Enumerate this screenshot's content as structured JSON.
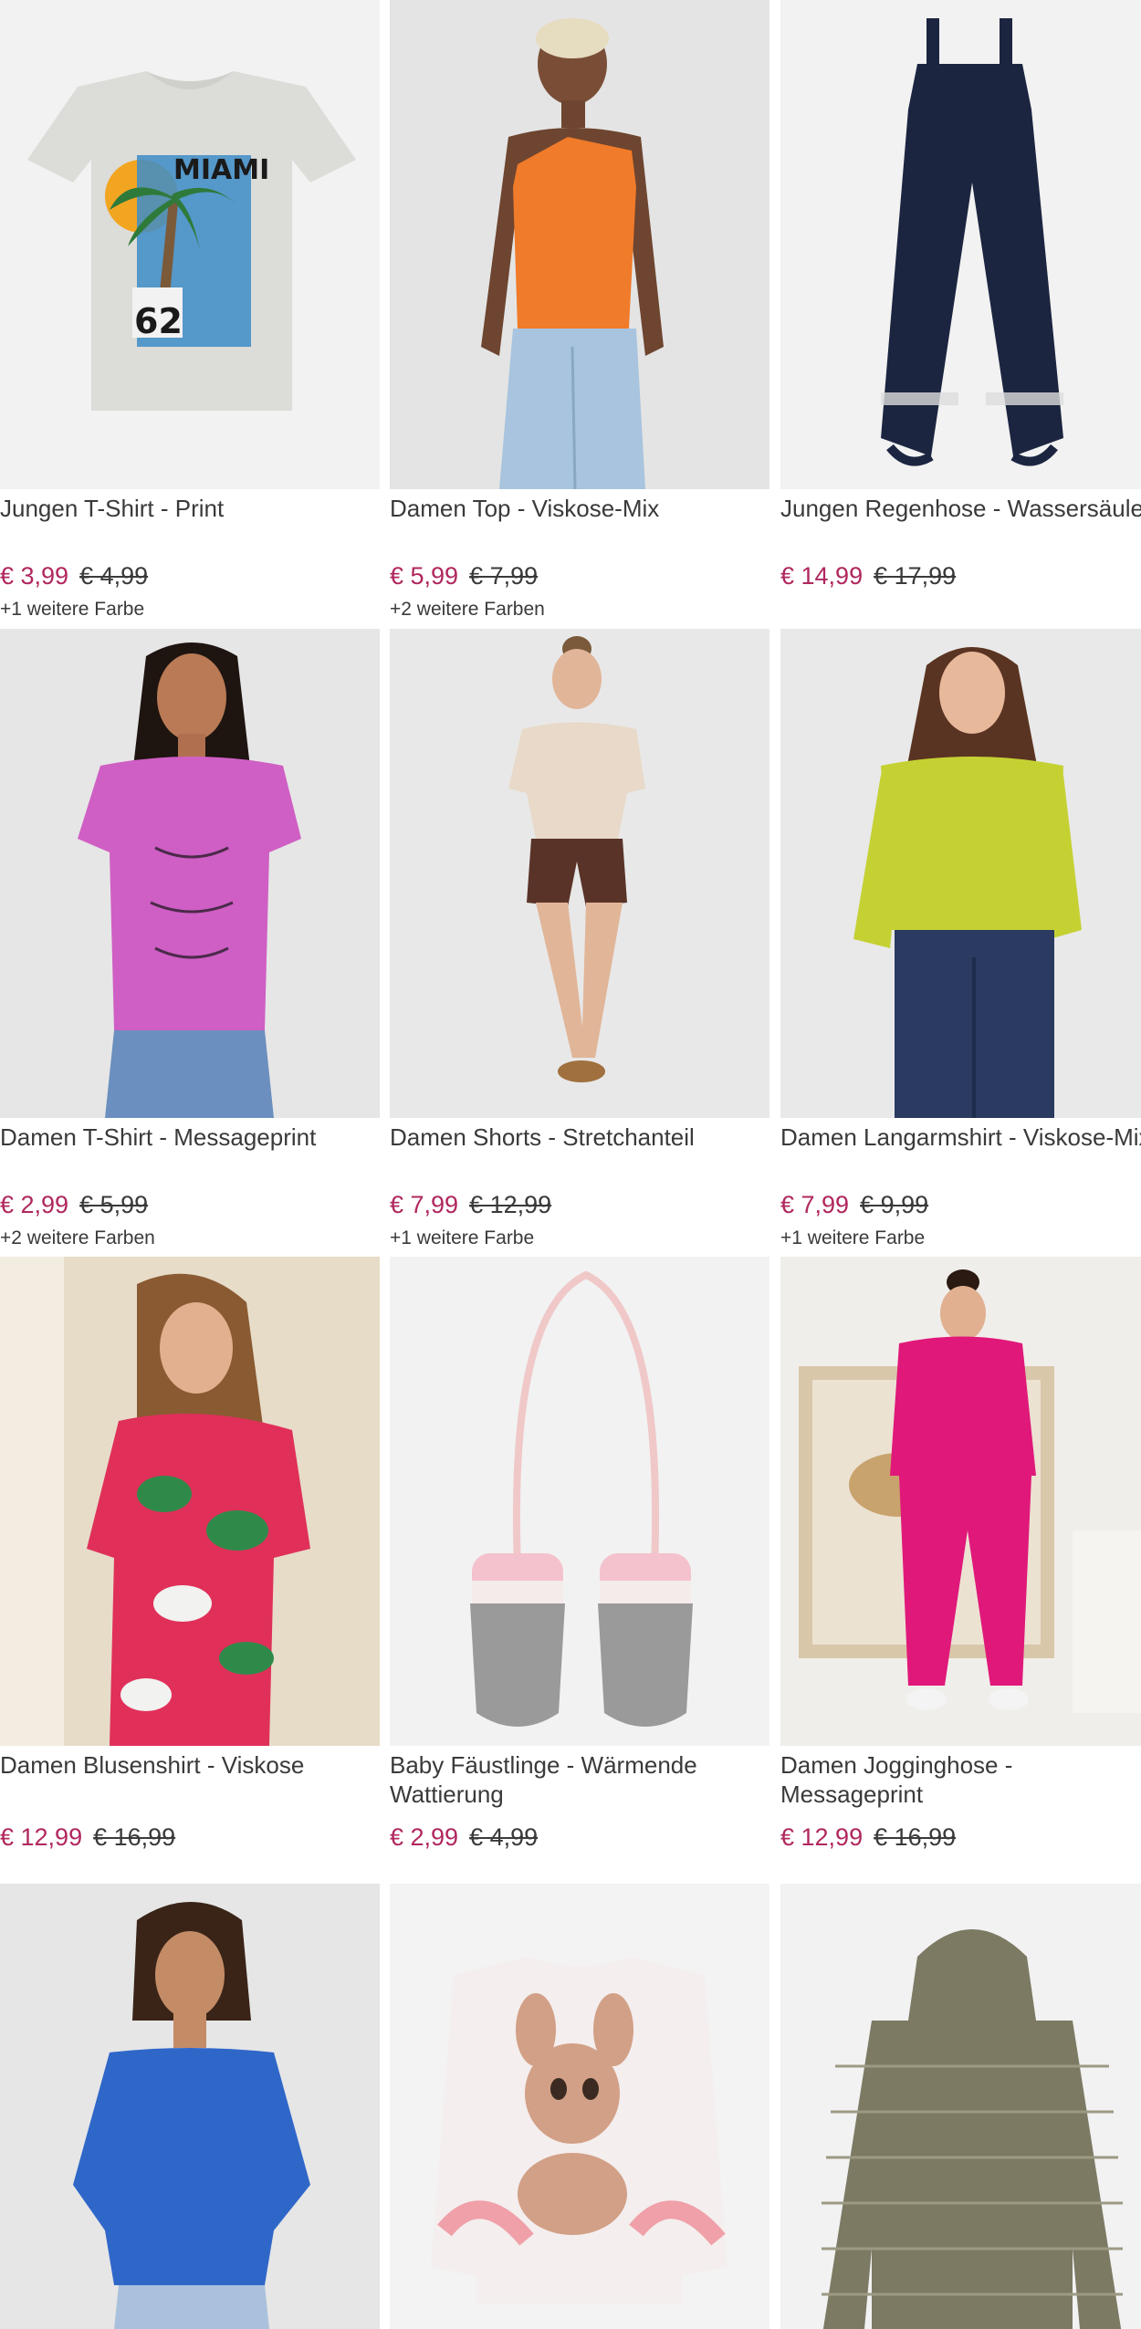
{
  "products": [
    {
      "title": "Jungen T-Shirt - Print",
      "price": "€ 3,99",
      "old_price": "€ 4,99",
      "colors": "+1 weitere Farbe",
      "image": "grey-tshirt-miami-print",
      "print_title": "MIAMI",
      "print_number": "62"
    },
    {
      "title": "Damen Top - Viskose-Mix",
      "price": "€ 5,99",
      "old_price": "€ 7,99",
      "colors": "+2 weitere Farben",
      "image": "orange-one-shoulder-top"
    },
    {
      "title": "Jungen Regenhose - Wassersäule",
      "price": "€ 14,99",
      "old_price": "€ 17,99",
      "colors": "",
      "image": "navy-rain-dungarees"
    },
    {
      "title": "Damen T-Shirt - Messageprint",
      "price": "€ 2,99",
      "old_price": "€ 5,99",
      "colors": "+2 weitere Farben",
      "image": "pink-message-tshirt"
    },
    {
      "title": "Damen Shorts - Stretchanteil",
      "price": "€ 7,99",
      "old_price": "€ 12,99",
      "colors": "+1 weitere Farbe",
      "image": "brown-shorts"
    },
    {
      "title": "Damen Langarmshirt - Viskose-Mix",
      "price": "€ 7,99",
      "old_price": "€ 9,99",
      "colors": "+1 weitere Farbe",
      "image": "lime-longsleeve"
    },
    {
      "title": "Damen Blusenshirt - Viskose",
      "price": "€ 12,99",
      "old_price": "€ 16,99",
      "colors": "",
      "image": "floral-blouse"
    },
    {
      "title": "Baby Fäustlinge - Wärmende Wattierung",
      "price": "€ 2,99",
      "old_price": "€ 4,99",
      "colors": "",
      "image": "baby-mittens"
    },
    {
      "title": "Damen Jogginghose - Messageprint",
      "price": "€ 12,99",
      "old_price": "€ 16,99",
      "colors": "",
      "image": "pink-jogging-suit"
    },
    {
      "title": "",
      "price": "",
      "old_price": "",
      "colors": "",
      "image": "blue-offshoulder-top"
    },
    {
      "title": "",
      "price": "",
      "old_price": "",
      "colors": "",
      "image": "fawn-fleece-sweater"
    },
    {
      "title": "",
      "price": "",
      "old_price": "",
      "colors": "",
      "image": "striped-hoodie"
    }
  ],
  "colors": {
    "price": "#b0275e",
    "text": "#3a3a3a",
    "image_background": "#eeeeee"
  }
}
